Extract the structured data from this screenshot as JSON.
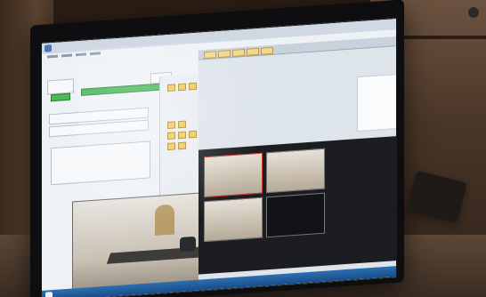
{
  "window": {
    "title": ""
  },
  "left_panel": {
    "header": ""
  },
  "right_panel": {
    "header": ""
  },
  "thumbnails": [
    {
      "label": ""
    },
    {
      "label": ""
    },
    {
      "label": ""
    },
    {
      "label": ""
    }
  ],
  "colors": {
    "meter_green": "#36b24a",
    "meter_red": "#d63a2f",
    "button_green": "#4cba5a",
    "accent_yellow": "#f0c94a",
    "taskbar_blue": "#2d6fb2"
  }
}
